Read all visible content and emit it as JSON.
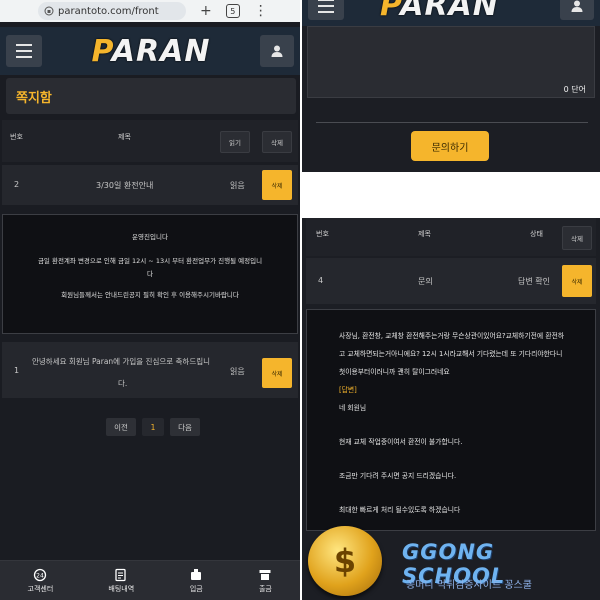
{
  "browser": {
    "url": "parantoto.com/front",
    "tab_count": "5"
  },
  "site": {
    "logo": "ARAN",
    "logo_p": "P"
  },
  "page_title": "쪽지함",
  "left_table": {
    "headers": {
      "no": "번호",
      "title": "제목",
      "read_btn": "읽기",
      "delete_btn": "삭제"
    },
    "rows": [
      {
        "no": "2",
        "title": "3/30일 환전안내",
        "status": "읽음",
        "action": "삭제"
      },
      {
        "no": "1",
        "title_line1": "안녕하세요 회원님 Paran에 가입을 진심으로 축하드립니",
        "title_line2": "다.",
        "status": "읽음",
        "action": "삭제"
      }
    ],
    "message": {
      "title": "운영진입니다",
      "line1": "금일 환전계좌 변경으로 인해 금일 12시 ~ 13시 부터 환전업무가 진행될 예정입니",
      "line2": "다",
      "line3": "회원님들께서는 안내드린공지 필히 확인 후 이용해주시기바랍니다"
    }
  },
  "pager": {
    "prev": "이전",
    "page": "1",
    "next": "다음"
  },
  "bottom_nav": [
    {
      "label": "고객센터",
      "icon": "headset-icon"
    },
    {
      "label": "배팅내역",
      "icon": "bet-history-icon"
    },
    {
      "label": "입금",
      "icon": "deposit-icon"
    },
    {
      "label": "출금",
      "icon": "withdraw-icon"
    }
  ],
  "right": {
    "counter": "0 단어",
    "inquire_btn": "문의하기",
    "headers": {
      "no": "번호",
      "title": "제목",
      "status": "상태",
      "delete_btn": "삭제"
    },
    "row": {
      "no": "4",
      "title": "문의",
      "status": "답변 확인",
      "action": "삭제"
    },
    "answer": {
      "q1": "사장님, 환전창, 교체창 환전해주는거랑 무슨상관이있어요?교체하기전에 환전하",
      "q2": "고 교체하면되는거아니에요? 12시 1시라교해서 기다렸는데 또 기다리야한다니",
      "q3": "첫이용부터이러니까 괜히 탈이그러네요",
      "label": "[답변]",
      "a1": "네 회원님",
      "a2": "현재 교체 작업중이여서 환전이 불가합니다.",
      "a3": "조금만 기다려 주시면 공지 드리겠습니다.",
      "a4": "최대한 빠르게 처리 될수있도록 하겠습니다"
    },
    "watermark": {
      "brand": "GGONG SCHOOL",
      "sub": "꽁머니 먹튀검증사이트 꽁스쿨",
      "coin": "$"
    }
  },
  "colors": {
    "accent": "#f5b52c",
    "bg": "#1a1c22",
    "header": "#1e2a38"
  }
}
